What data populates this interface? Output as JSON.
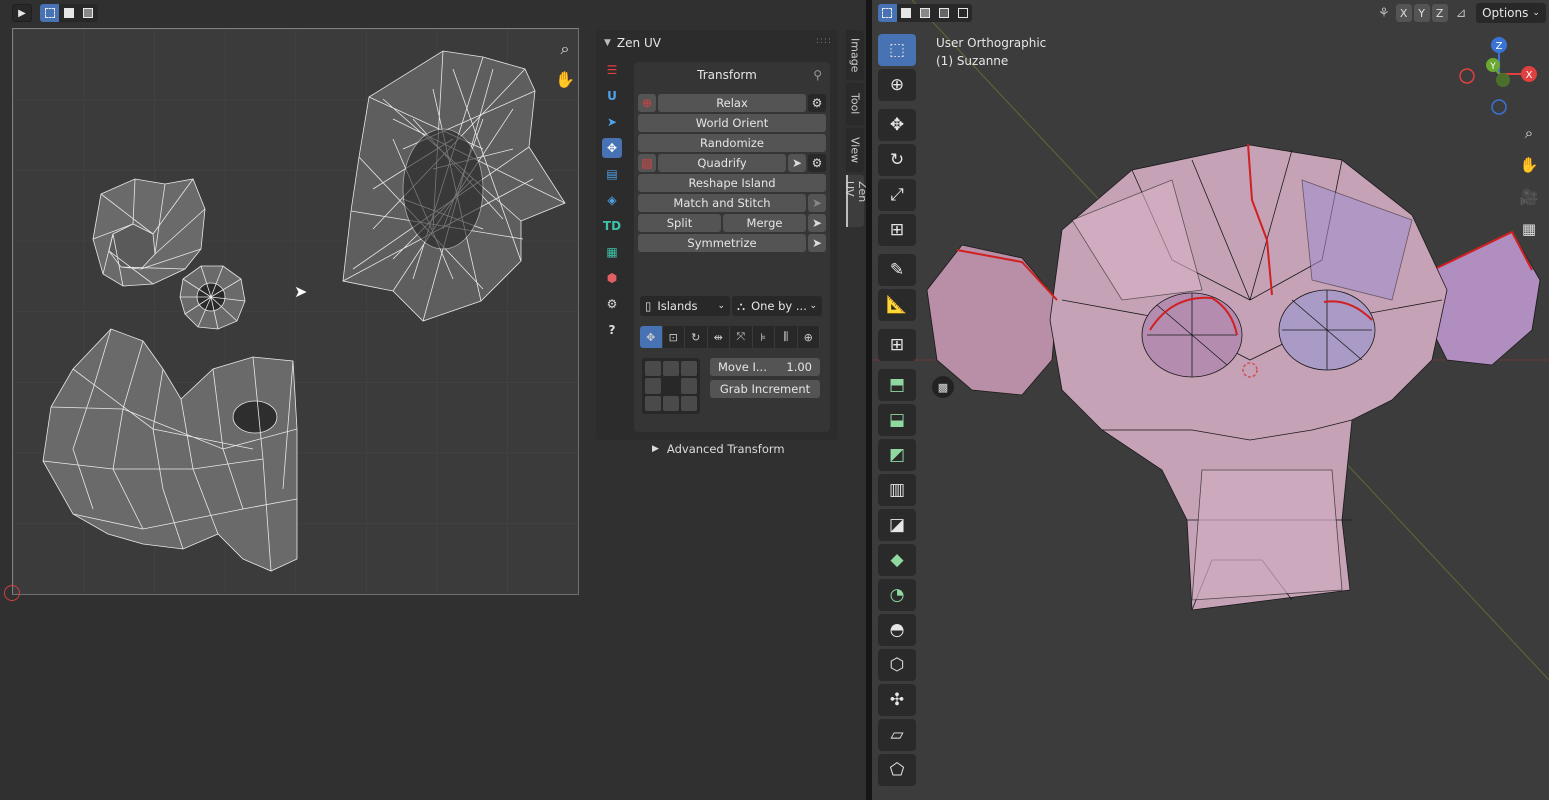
{
  "uv_editor": {
    "header": {
      "mode_icon": "cursor-icon"
    }
  },
  "zen_panel": {
    "title": "Zen UV",
    "side_icons": [
      "list-icon",
      "u-icon",
      "cursor-icon",
      "transform-icon",
      "table-icon",
      "layers-icon",
      "TD",
      "checker-icon",
      "cube-icon",
      "gear-icon",
      "help-icon"
    ],
    "transform": {
      "title": "Transform",
      "relax": "Relax",
      "world_orient": "World Orient",
      "randomize": "Randomize",
      "quadrify": "Quadrify",
      "reshape_island": "Reshape Island",
      "match_and_stitch": "Match and Stitch",
      "split": "Split",
      "merge": "Merge",
      "symmetrize": "Symmetrize",
      "islands_dropdown": "Islands",
      "one_by_dropdown": "One by ...",
      "move_increment_label": "Move I...",
      "move_increment_value": "1.00",
      "grab_increment": "Grab Increment",
      "advanced_transform": "Advanced Transform"
    }
  },
  "vertical_tabs": [
    "Image",
    "Tool",
    "View",
    "Zen UV"
  ],
  "viewport": {
    "view_name": "User Orthographic",
    "object_name": "(1) Suzanne",
    "axis_buttons": [
      "X",
      "Y",
      "Z"
    ],
    "options_label": "Options",
    "gizmo": {
      "z": "Z",
      "y": "Y",
      "x": "X"
    },
    "colors": {
      "x_axis": "#e0403f",
      "y_axis": "#6ba832",
      "z_axis": "#3a73d6",
      "seam": "#d02020",
      "active": "#4772b3"
    }
  }
}
